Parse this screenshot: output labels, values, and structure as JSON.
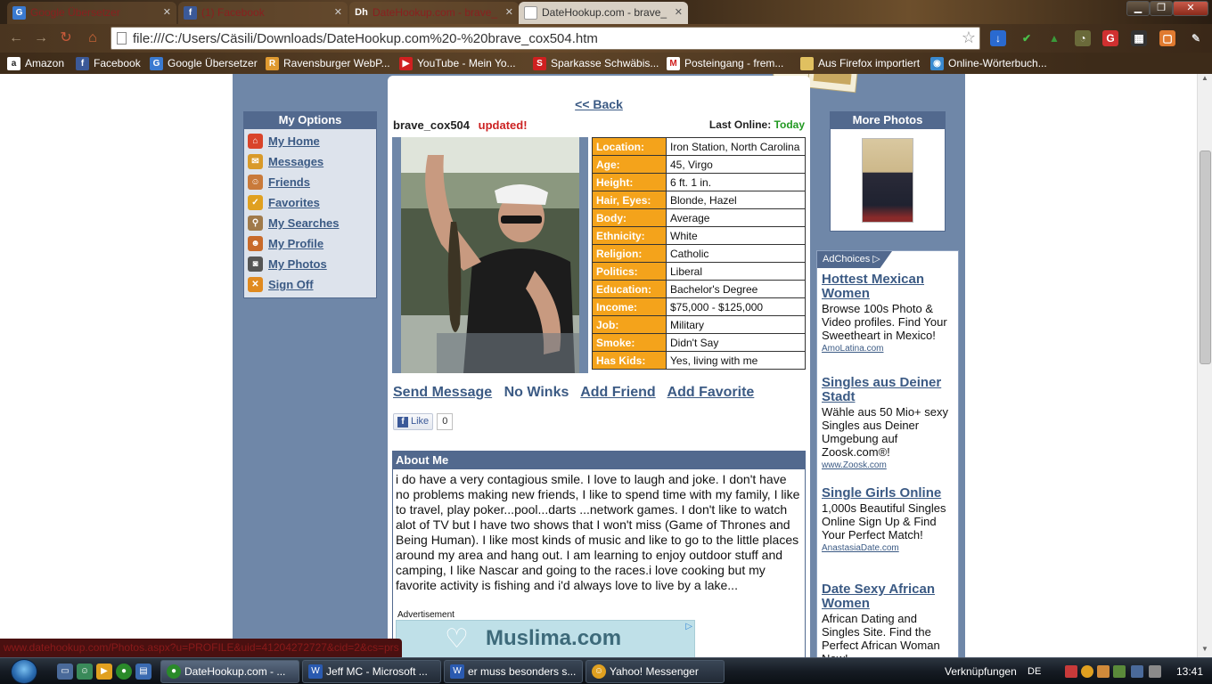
{
  "browser": {
    "tabs": [
      {
        "title": "Google Übersetzer",
        "active": false
      },
      {
        "title": "(1) Facebook",
        "active": false
      },
      {
        "title": "DateHookup.com - brave_",
        "active": false
      },
      {
        "title": "DateHookup.com - brave_",
        "active": true
      }
    ],
    "url": "file:///C:/Users/Cäsili/Downloads/DateHookup.com%20-%20brave_cox504.htm",
    "bookmarks": [
      "Amazon",
      "Facebook",
      "Google Übersetzer",
      "Ravensburger WebP...",
      "YouTube - Mein Yo...",
      "Sparkasse Schwäbis...",
      "Posteingang - frem...",
      "Aus Firefox importiert",
      "Online-Wörterbuch..."
    ]
  },
  "sidebar": {
    "title": "My Options",
    "items": [
      {
        "label": "My Home",
        "icon": "home-icon",
        "color": "#d9442a"
      },
      {
        "label": "Messages",
        "icon": "envelope-icon",
        "color": "#d99a2a"
      },
      {
        "label": "Friends",
        "icon": "friends-icon",
        "color": "#c97a3a"
      },
      {
        "label": "Favorites",
        "icon": "checkmark-icon",
        "color": "#e0a020"
      },
      {
        "label": "My Searches",
        "icon": "magnifier-icon",
        "color": "#a07a4a"
      },
      {
        "label": "My Profile",
        "icon": "profile-icon",
        "color": "#c86a2a"
      },
      {
        "label": "My Photos",
        "icon": "camera-icon",
        "color": "#555555"
      },
      {
        "label": "Sign Off",
        "icon": "signoff-icon",
        "color": "#e08a20"
      }
    ]
  },
  "profile": {
    "back_label": "<< Back",
    "username": "brave_cox504",
    "updated_label": "updated!",
    "last_online_label": "Last Online:",
    "last_online_value": "Today",
    "details": [
      {
        "key": "Location:",
        "value": "Iron Station, North Carolina"
      },
      {
        "key": "Age:",
        "value": "45, Virgo"
      },
      {
        "key": "Height:",
        "value": "6 ft. 1 in."
      },
      {
        "key": "Hair, Eyes:",
        "value": "Blonde, Hazel"
      },
      {
        "key": "Body:",
        "value": "Average"
      },
      {
        "key": "Ethnicity:",
        "value": "White"
      },
      {
        "key": "Religion:",
        "value": "Catholic"
      },
      {
        "key": "Politics:",
        "value": "Liberal"
      },
      {
        "key": "Education:",
        "value": "Bachelor's Degree"
      },
      {
        "key": "Income:",
        "value": "$75,000 - $125,000"
      },
      {
        "key": "Job:",
        "value": "Military"
      },
      {
        "key": "Smoke:",
        "value": "Didn't Say"
      },
      {
        "key": "Has Kids:",
        "value": "Yes, living with me"
      }
    ],
    "actions": {
      "send_message": "Send Message",
      "winks": "No Winks",
      "add_friend": "Add Friend",
      "add_favorite": "Add Favorite"
    },
    "like": {
      "label": "Like",
      "count": "0"
    },
    "about_title": "About Me",
    "about_text": "i do have a very contagious smile. I love to laugh and joke. I don't have no problems making new friends, I like to spend time with my family, I like to travel, play poker...pool...darts ...network games. I don't like to watch alot of TV but I have two shows that I won't miss (Game of Thrones and Being Human). I like most kinds of music and like to go to the little places around my area and hang out. I am learning to enjoy outdoor stuff and camping, I like Nascar and going to the races.i love cooking but my favorite activity is fishing and i'd always love to live by a lake...",
    "ad_label": "Advertisement",
    "banner_text": "Muslima.com"
  },
  "right": {
    "more_photos_title": "More Photos",
    "adchoices_label": "AdChoices",
    "ads": [
      {
        "title": "Hottest Mexican Women",
        "body": "Browse 100s Photo & Video profiles. Find Your Sweetheart in Mexico!",
        "url": "AmoLatina.com"
      },
      {
        "title": "Singles aus Deiner Stadt",
        "body": "Wähle aus 50 Mio+ sexy Singles aus Deiner Umgebung auf Zoosk.com®!",
        "url": "www.Zoosk.com"
      },
      {
        "title": "Single Girls Online",
        "body": "1,000s Beautiful Singles Online Sign Up & Find Your Perfect Match!",
        "url": "AnastasiaDate.com"
      },
      {
        "title": "Date Sexy African Women",
        "body": "African Dating and Singles Site. Find the Perfect African Woman Now!",
        "url": ""
      }
    ]
  },
  "status_url": "www.datehookup.com/Photos.aspx?u=PROFILE&uid=41204272727&cid=2&cs=prs",
  "taskbar": {
    "tasks": [
      {
        "label": "DateHookup.com - ...",
        "active": true,
        "color": "#2a8a2a"
      },
      {
        "label": "Jeff MC - Microsoft ...",
        "active": false,
        "color": "#2a5ab0"
      },
      {
        "label": "er muss besonders s...",
        "active": false,
        "color": "#2a5ab0"
      },
      {
        "label": "Yahoo! Messenger",
        "active": false,
        "color": "#e0a020"
      }
    ],
    "links_label": "Verknüpfungen",
    "language": "DE",
    "clock": "13:41"
  }
}
